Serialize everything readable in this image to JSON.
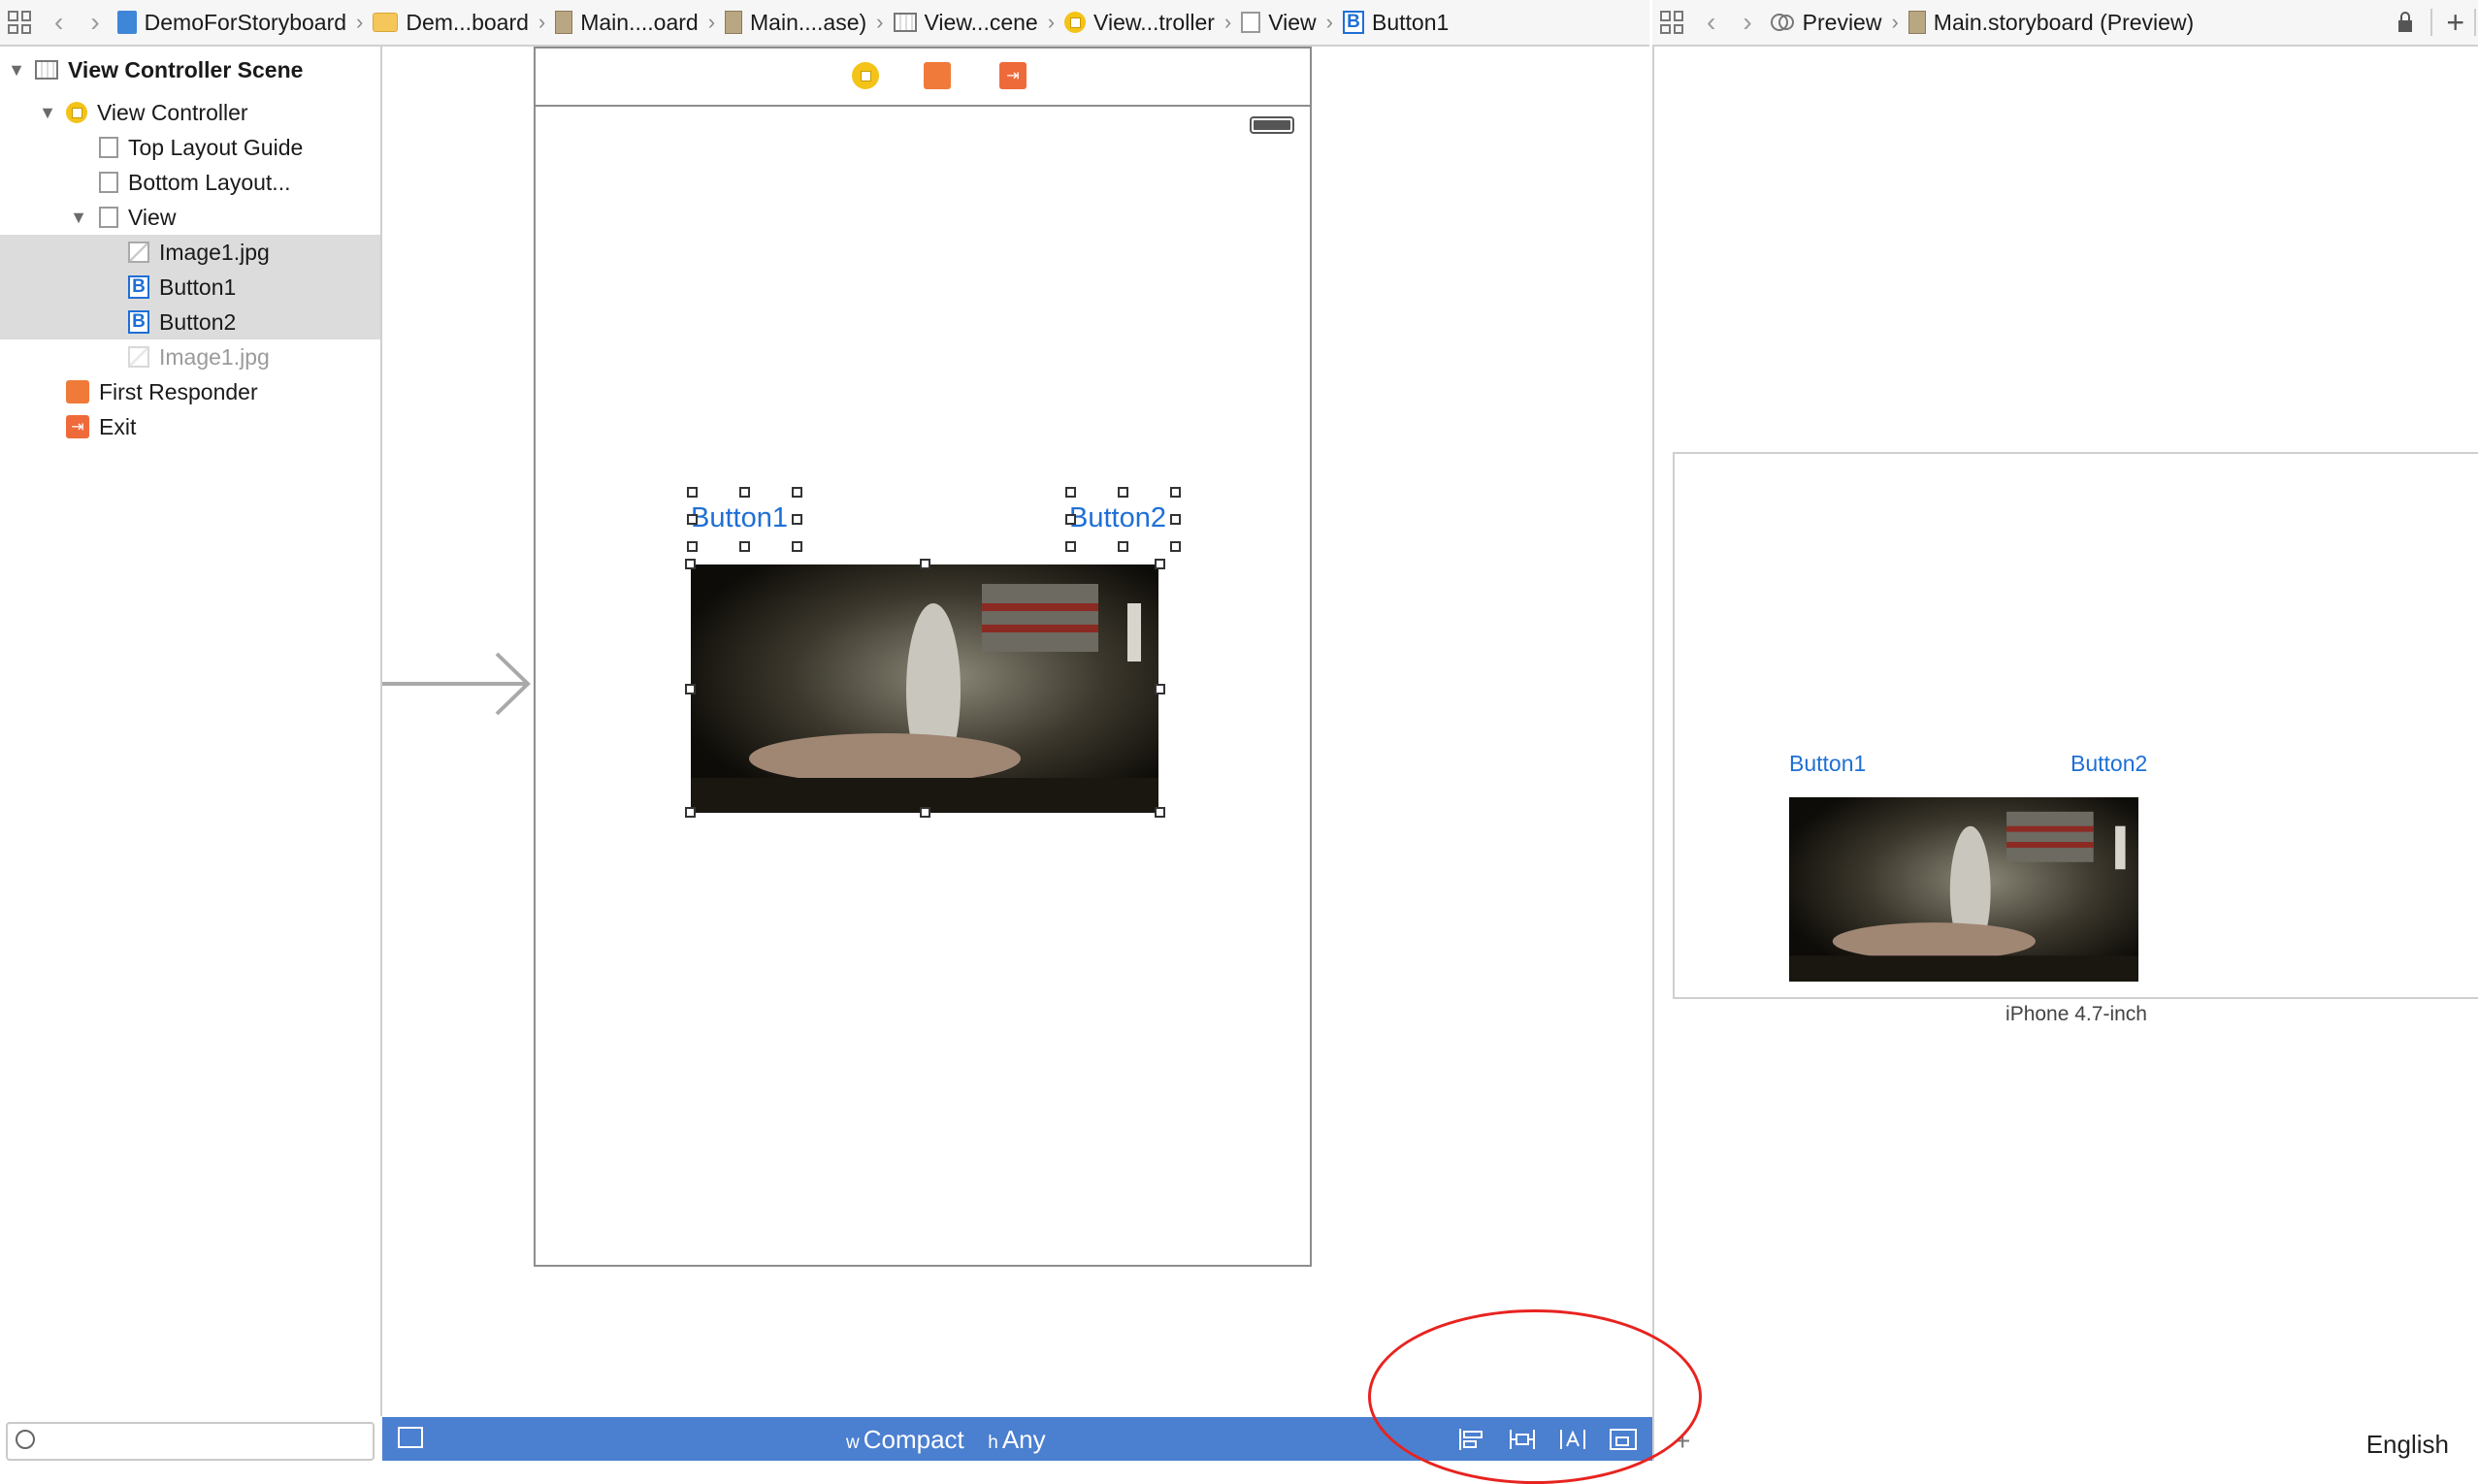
{
  "breadcrumb_left": [
    {
      "icon": "project-icon",
      "label": "DemoForStoryboard"
    },
    {
      "icon": "folder-icon",
      "label": "Dem...board"
    },
    {
      "icon": "storyboard-file-icon",
      "label": "Main....oard"
    },
    {
      "icon": "storyboard-file-icon",
      "label": "Main....ase)"
    },
    {
      "icon": "scene-icon",
      "label": "View...cene"
    },
    {
      "icon": "view-controller-icon",
      "label": "View...troller"
    },
    {
      "icon": "view-icon",
      "label": "View"
    },
    {
      "icon": "button-icon",
      "label": "Button1"
    }
  ],
  "breadcrumb_right": [
    {
      "icon": "preview-icon",
      "label": "Preview"
    },
    {
      "icon": "storyboard-file-icon",
      "label": "Main.storyboard (Preview)"
    }
  ],
  "outline": {
    "scene_title": "View Controller Scene",
    "items": [
      {
        "label": "View Controller",
        "icon": "view-controller-icon"
      },
      {
        "label": "Top Layout Guide",
        "icon": "layout-guide-icon"
      },
      {
        "label": "Bottom Layout...",
        "icon": "layout-guide-icon"
      },
      {
        "label": "View",
        "icon": "view-icon"
      },
      {
        "label": "Image1.jpg",
        "icon": "image-view-icon",
        "selected": true
      },
      {
        "label": "Button1",
        "icon": "button-icon",
        "selected": true
      },
      {
        "label": "Button2",
        "icon": "button-icon",
        "selected": true
      },
      {
        "label": "Image1.jpg",
        "icon": "image-view-icon",
        "dimmed": true
      },
      {
        "label": "First Responder",
        "icon": "first-responder-icon"
      },
      {
        "label": "Exit",
        "icon": "exit-icon"
      }
    ]
  },
  "canvas": {
    "button1_label": "Button1",
    "button2_label": "Button2"
  },
  "size_class": {
    "w_prefix": "w",
    "w_value": "Compact",
    "h_prefix": "h",
    "h_value": "Any"
  },
  "preview": {
    "button1_label": "Button1",
    "button2_label": "Button2",
    "device": "iPhone 4.7-inch",
    "language": "English"
  },
  "colors": {
    "accent": "#1e6fd6",
    "size_bar": "#4b7fd0",
    "annotation": "#e8231f",
    "selection": "#dcdcdc"
  }
}
